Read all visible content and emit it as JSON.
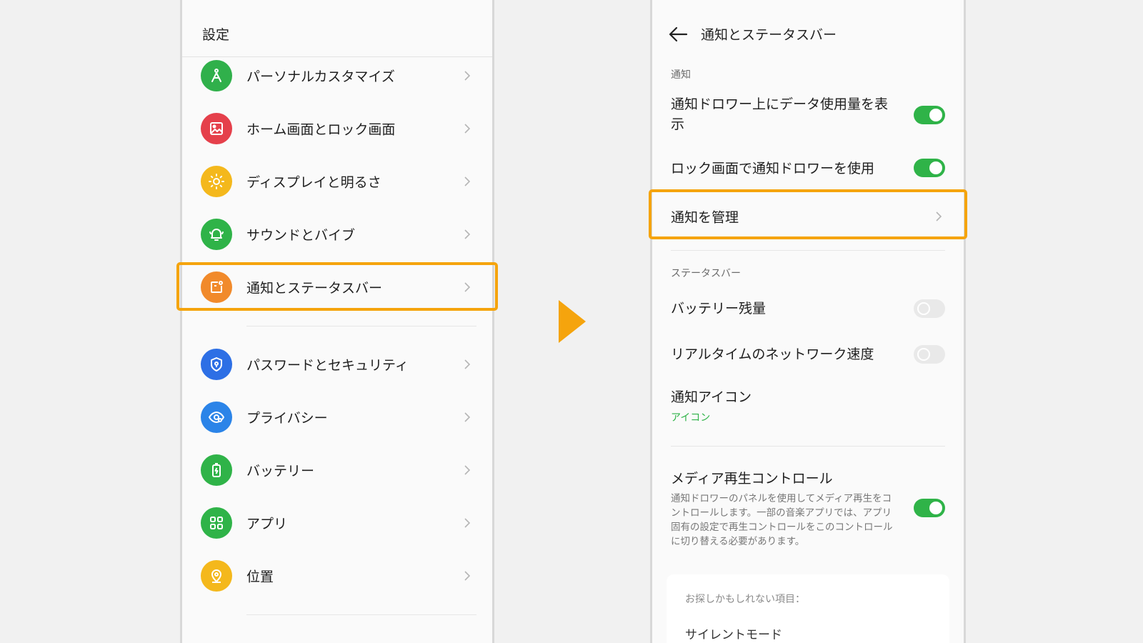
{
  "left": {
    "title": "設定",
    "items": [
      {
        "label": "パーソナルカスタマイズ",
        "icon": "personalize-icon",
        "color": "#30b04b"
      },
      {
        "label": "ホーム画面とロック画面",
        "icon": "wallpaper-icon",
        "color": "#e5404b"
      },
      {
        "label": "ディスプレイと明るさ",
        "icon": "brightness-icon",
        "color": "#f4b81c"
      },
      {
        "label": "サウンドとバイブ",
        "icon": "bell-icon",
        "color": "#2fb348"
      },
      {
        "label": "通知とステータスバー",
        "icon": "notification-icon",
        "color": "#f18a2b"
      },
      {
        "label": "パスワードとセキュリティ",
        "icon": "shield-icon",
        "color": "#2d6fe5"
      },
      {
        "label": "プライバシー",
        "icon": "privacy-eye-icon",
        "color": "#2b84e8"
      },
      {
        "label": "バッテリー",
        "icon": "battery-icon",
        "color": "#2fb348"
      },
      {
        "label": "アプリ",
        "icon": "apps-grid-icon",
        "color": "#2fb348"
      },
      {
        "label": "位置",
        "icon": "location-icon",
        "color": "#f4b81c"
      }
    ]
  },
  "right": {
    "title": "通知とステータスバー",
    "notification_section": "通知",
    "data_usage_label": "通知ドロワー上にデータ使用量を表示",
    "data_usage_on": true,
    "lock_drawer_label": "ロック画面で通知ドロワーを使用",
    "lock_drawer_on": true,
    "manage_label": "通知を管理",
    "status_section": "ステータスバー",
    "battery_label": "バッテリー残量",
    "battery_on": false,
    "network_speed_label": "リアルタイムのネットワーク速度",
    "network_speed_on": false,
    "notif_icon_label": "通知アイコン",
    "notif_icon_value": "アイコン",
    "media_label": "メディア再生コントロール",
    "media_desc": "通知ドロワーのパネルを使用してメディア再生をコントロールします。一部の音楽アプリでは、アプリ固有の設定で再生コントロールをこのコントロールに切り替える必要があります。",
    "media_on": true,
    "suggest_label": "お探しかもしれない項目：",
    "suggest_item": "サイレントモード"
  },
  "colors": {
    "highlight": "#f5a40d",
    "toggle_on": "#2fb348",
    "arrow": "#f5a40d"
  }
}
